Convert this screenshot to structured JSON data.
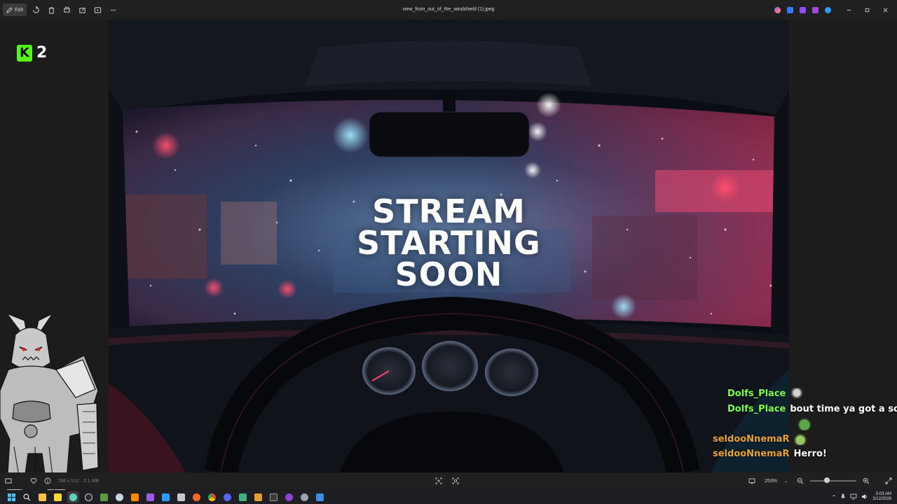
{
  "window": {
    "title": "view_from_out_of_the_windshield (1).jpeg",
    "edit_label": "Edit"
  },
  "image": {
    "headline_lines": [
      "STREAM",
      "STARTING",
      "SOON"
    ]
  },
  "overlay": {
    "kick_count": "2",
    "kick_letter": "K"
  },
  "chat": {
    "messages": [
      {
        "user": "Dolfs_Place",
        "text": "",
        "user_color": "#7cff4f",
        "emote": "knight-emote"
      },
      {
        "user": "Dolfs_Place",
        "text": "bout time ya got a screen",
        "user_color": "#7cff4f",
        "emote": ""
      },
      {
        "user": "",
        "text": "",
        "user_color": "#7cff4f",
        "emote": "pepe-emote"
      },
      {
        "user": "seldooNnemaR",
        "text": "",
        "user_color": "#e8a43c",
        "emote": "frog-emote"
      },
      {
        "user": "seldooNnemaR",
        "text": "Herro!",
        "user_color": "#e8a43c",
        "emote": ""
      }
    ]
  },
  "statusbar": {
    "info": "768 x 512 · 2.1 MB",
    "zoom": "253%"
  },
  "taskbar": {
    "time": "5:03 AM",
    "date": "3/12/2026"
  },
  "colors": {
    "kick_green": "#53fc18",
    "accent": "#4cc2ff"
  }
}
